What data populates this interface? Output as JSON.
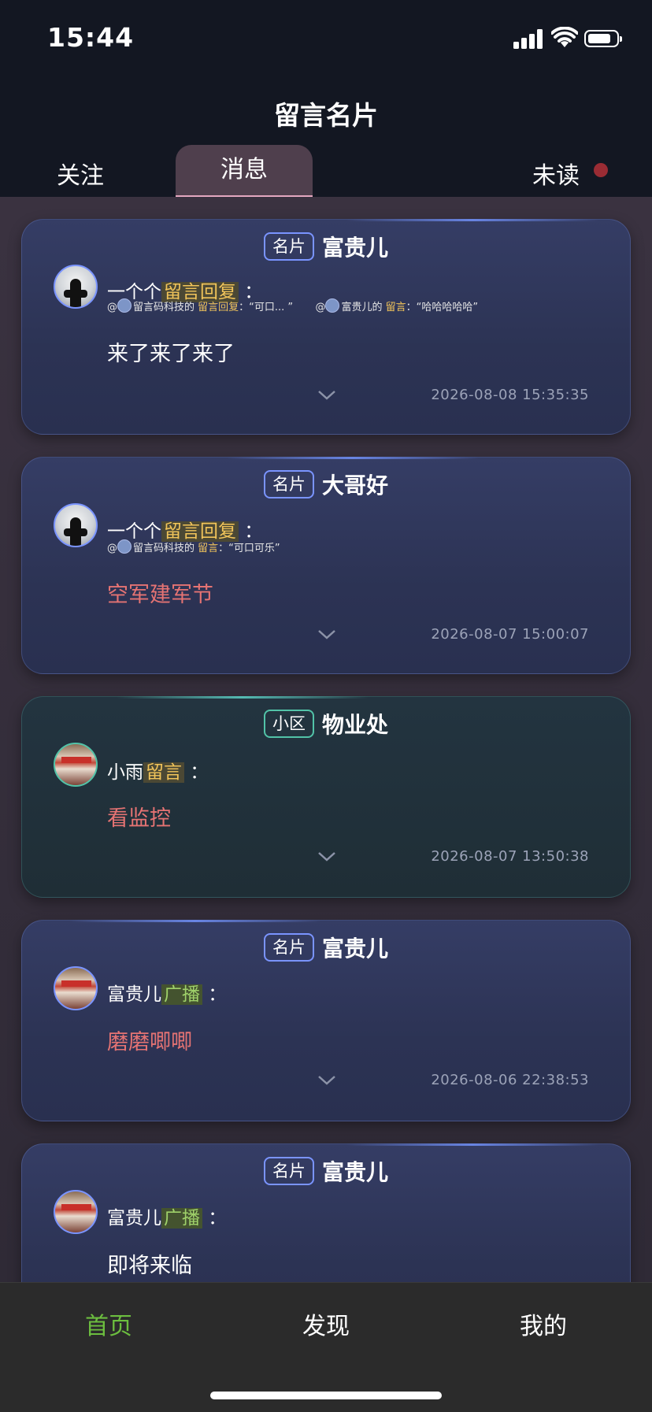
{
  "status_bar": {
    "time": "15:44"
  },
  "header": {
    "title": "留言名片",
    "tabs": {
      "follow": "关注",
      "messages": "消息",
      "unread": "未读"
    }
  },
  "cards": [
    {
      "tag": "名片",
      "name": "富贵儿",
      "sender": "一个个",
      "action": "留言回复",
      "colon": "：",
      "quote1": {
        "at": "@",
        "who": "留言码科技的",
        "kind": "留言回复",
        "text": "：“可口... ”"
      },
      "quote2": {
        "at": "@",
        "who": "富贵儿的",
        "kind": "留言",
        "text": "：“哈哈哈哈哈”"
      },
      "message": "来了来了来了",
      "timestamp": "2026-08-08 15:35:35"
    },
    {
      "tag": "名片",
      "name": "大哥好",
      "sender": "一个个",
      "action": "留言回复",
      "colon": "：",
      "quote1": {
        "at": "@",
        "who": "留言码科技的",
        "kind": "留言",
        "text": "：“可口可乐”"
      },
      "message": "空军建军节",
      "timestamp": "2026-08-07 15:00:07"
    },
    {
      "tag": "小区",
      "name": "物业处",
      "sender": "小雨",
      "action": "留言",
      "colon": "：",
      "message": "看监控",
      "timestamp": "2026-08-07 13:50:38"
    },
    {
      "tag": "名片",
      "name": "富贵儿",
      "sender": "富贵儿",
      "action": "广播",
      "colon": "：",
      "message": "磨磨唧唧",
      "timestamp": "2026-08-06 22:38:53"
    },
    {
      "tag": "名片",
      "name": "富贵儿",
      "sender": "富贵儿",
      "action": "广播",
      "colon": "：",
      "message": "即将来临"
    }
  ],
  "bottom_nav": {
    "home": "首页",
    "discover": "发现",
    "mine": "我的"
  },
  "colors": {
    "accent_green": "#6cbe3f",
    "unread_dot": "#9a2c34",
    "highlight_yellow": "#f1c45a",
    "message_red": "#e57373"
  }
}
